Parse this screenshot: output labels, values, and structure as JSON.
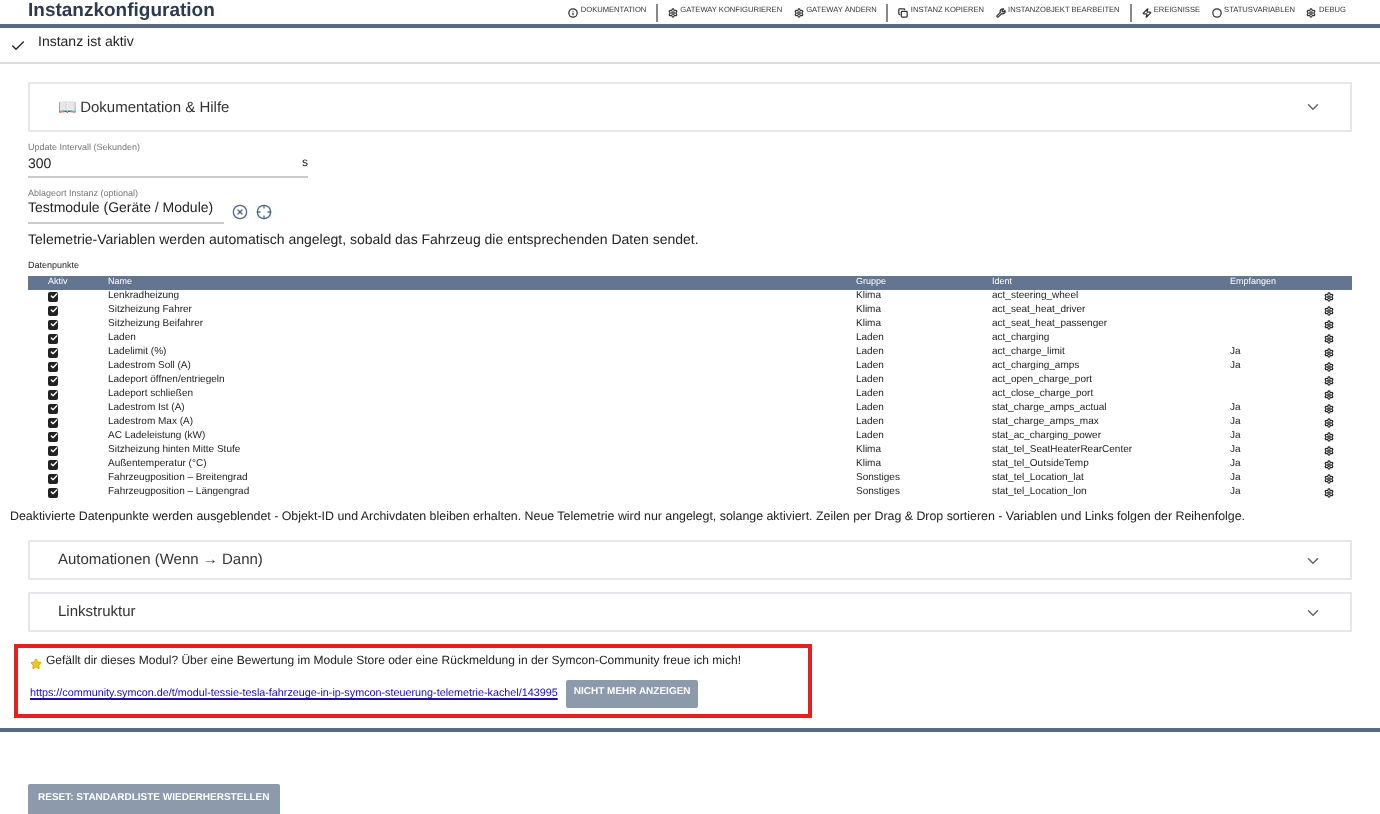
{
  "window": {
    "title": "Instanzkonfiguration"
  },
  "toolbar_groups": [
    [
      {
        "label": "DOKUMENTATION",
        "kind": "info"
      }
    ],
    [
      {
        "label": "GATEWAY KONFIGURIEREN",
        "kind": "gear"
      },
      {
        "label": "GATEWAY ÄNDERN",
        "kind": "gear"
      }
    ],
    [
      {
        "label": "INSTANZ KOPIEREN",
        "kind": "copy"
      },
      {
        "label": "INSTANZOBJEKT BEARBEITEN",
        "kind": "wrench"
      }
    ],
    [
      {
        "label": "EREIGNISSE",
        "kind": "bolt"
      },
      {
        "label": "STATUSVARIABLEN",
        "kind": "circle"
      },
      {
        "label": "DEBUG",
        "kind": "gear"
      }
    ]
  ],
  "status": {
    "text": "Instanz ist aktiv",
    "active": true
  },
  "doc_panel": {
    "title": "📖 Dokumentation & Hilfe",
    "expanded": false
  },
  "interval": {
    "label": "Update Intervall (Sekunden)",
    "value": "300",
    "unit": "s"
  },
  "location": {
    "label": "Ablageort Instanz (optional)",
    "value": "Testmodule (Geräte / Module)"
  },
  "info_text": "Telemetrie-Variablen werden automatisch angelegt, sobald das Fahrzeug die entsprechenden Daten sendet.",
  "table": {
    "title": "Datenpunkte",
    "columns": [
      "Aktiv",
      "Name",
      "Gruppe",
      "Ident",
      "Empfangen"
    ],
    "rows": [
      {
        "active": true,
        "name": "Lenkradheizung",
        "group": "Klima",
        "ident": "act_steering_wheel"
      },
      {
        "active": true,
        "name": "Sitzheizung Fahrer",
        "group": "Klima",
        "ident": "act_seat_heat_driver"
      },
      {
        "active": true,
        "name": "Sitzheizung Beifahrer",
        "group": "Klima",
        "ident": "act_seat_heat_passenger"
      },
      {
        "active": true,
        "name": "Laden",
        "group": "Laden",
        "ident": "act_charging"
      },
      {
        "active": true,
        "name": "Ladelimit (%)",
        "group": "Laden",
        "ident": "act_charge_limit",
        "received": "Ja"
      },
      {
        "active": true,
        "name": "Ladestrom Soll (A)",
        "group": "Laden",
        "ident": "act_charging_amps",
        "received": "Ja"
      },
      {
        "active": true,
        "name": "Ladeport öffnen/entriegeln",
        "group": "Laden",
        "ident": "act_open_charge_port"
      },
      {
        "active": true,
        "name": "Ladeport schließen",
        "group": "Laden",
        "ident": "act_close_charge_port"
      },
      {
        "active": true,
        "name": "Ladestrom Ist (A)",
        "group": "Laden",
        "ident": "stat_charge_amps_actual",
        "received": "Ja"
      },
      {
        "active": true,
        "name": "Ladestrom Max (A)",
        "group": "Laden",
        "ident": "stat_charge_amps_max",
        "received": "Ja"
      },
      {
        "active": true,
        "name": "AC Ladeleistung (kW)",
        "group": "Laden",
        "ident": "stat_ac_charging_power",
        "received": "Ja"
      },
      {
        "active": true,
        "name": "Sitzheizung hinten Mitte Stufe",
        "group": "Klima",
        "ident": "stat_tel_SeatHeaterRearCenter",
        "received": "Ja"
      },
      {
        "active": true,
        "name": "Außentemperatur (°C)",
        "group": "Klima",
        "ident": "stat_tel_OutsideTemp",
        "received": "Ja"
      },
      {
        "active": true,
        "name": "Fahrzeugposition – Breitengrad",
        "group": "Sonstiges",
        "ident": "stat_tel_Location_lat",
        "received": "Ja"
      },
      {
        "active": true,
        "name": "Fahrzeugposition – Längengrad",
        "group": "Sonstiges",
        "ident": "stat_tel_Location_lon",
        "received": "Ja"
      }
    ]
  },
  "note": "Deaktivierte Datenpunkte werden ausgeblendet - Objekt-ID und Archivdaten bleiben erhalten. Neue Telemetrie wird nur angelegt, solange aktiviert. Zeilen per Drag & Drop sortieren - Variablen und Links folgen der Reihenfolge.",
  "panels": [
    {
      "title": "Automationen (Wenn → Dann)",
      "expanded": false
    },
    {
      "title": "Linkstruktur",
      "expanded": false
    }
  ],
  "feedback": {
    "text": "Gefällt dir dieses Modul? Über eine Bewertung im Module Store oder eine Rückmeldung in der Symcon-Community freue ich mich!",
    "link": "https://community.symcon.de/t/modul-tessie-tesla-fahrzeuge-in-ip-symcon-steuerung-telemetrie-kachel/143995",
    "button": "NICHT MEHR ANZEIGEN"
  },
  "reset_button": "RESET: STANDARDLISTE WIEDERHERSTELLEN"
}
